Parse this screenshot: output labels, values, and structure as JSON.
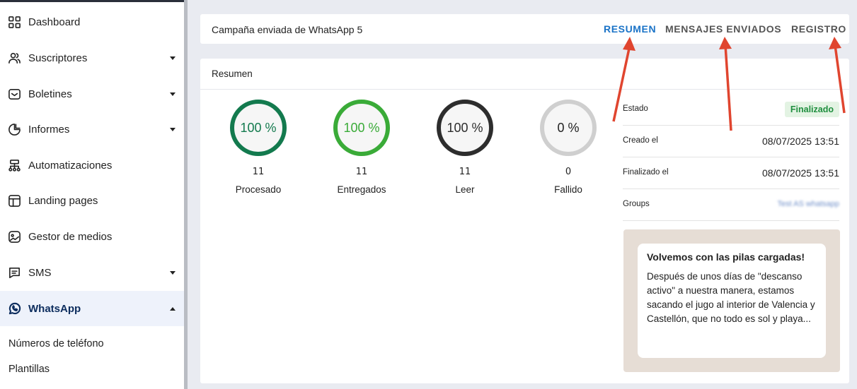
{
  "sidebar": {
    "items": [
      {
        "label": "Dashboard",
        "icon": "grid-icon"
      },
      {
        "label": "Suscriptores",
        "icon": "users-icon"
      },
      {
        "label": "Boletines",
        "icon": "inbox-icon"
      },
      {
        "label": "Informes",
        "icon": "pie-chart-icon"
      },
      {
        "label": "Automatizaciones",
        "icon": "sitemap-icon"
      },
      {
        "label": "Landing pages",
        "icon": "layout-icon"
      },
      {
        "label": "Gestor de medios",
        "icon": "image-icon"
      },
      {
        "label": "SMS",
        "icon": "message-icon"
      },
      {
        "label": "WhatsApp",
        "icon": "whatsapp-icon"
      }
    ],
    "subitems": [
      {
        "label": "Números de teléfono"
      },
      {
        "label": "Plantillas"
      }
    ]
  },
  "header": {
    "title": "Campaña enviada de WhatsApp 5",
    "tabs": [
      {
        "label": "RESUMEN"
      },
      {
        "label": "MENSAJES ENVIADOS"
      },
      {
        "label": "REGISTRO"
      }
    ]
  },
  "summary": {
    "title": "Resumen",
    "stats": [
      {
        "percent": "100 %",
        "count": "11",
        "label": "Procesado",
        "color": "#137a4e"
      },
      {
        "percent": "100 %",
        "count": "11",
        "label": "Entregados",
        "color": "#3aab38"
      },
      {
        "percent": "100 %",
        "count": "11",
        "label": "Leer",
        "color": "#2d2d2d"
      },
      {
        "percent": "0 %",
        "count": "0",
        "label": "Fallido",
        "color": "#cfcfcf"
      }
    ]
  },
  "details": {
    "estado_label": "Estado",
    "estado_value": "Finalizado",
    "creado_label": "Creado el",
    "creado_value": "08/07/2025 13:51",
    "finalizado_label": "Finalizado el",
    "finalizado_value": "08/07/2025 13:51",
    "groups_label": "Groups",
    "groups_value": "Test AS whatsapp"
  },
  "preview": {
    "title": "Volvemos con las pilas cargadas!",
    "body": "Después de unos días de \"descanso activo\" a nuestra manera, estamos sacando el jugo al interior de Valencia y Castellón, que no todo es sol y playa..."
  },
  "colors": {
    "accent": "#1a73c7",
    "annotation_arrow": "#e0452f",
    "badge_green": "#1e8e3e"
  }
}
